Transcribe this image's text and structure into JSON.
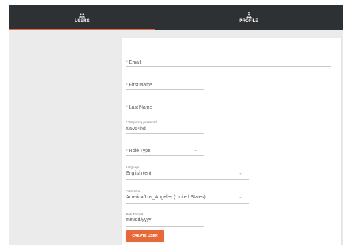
{
  "tabs": {
    "users": {
      "label": "USERS",
      "icon": "users-icon"
    },
    "profile": {
      "label": "PROFILE",
      "icon": "user-icon"
    }
  },
  "form": {
    "email": {
      "placeholder": "* Email"
    },
    "first_name": {
      "placeholder": "* First Name"
    },
    "last_name": {
      "placeholder": "* Last Name"
    },
    "temp_password": {
      "label": "* Temporary password",
      "value": "fu5v54hd"
    },
    "role_type": {
      "placeholder": "* Role Type"
    },
    "language": {
      "label": "Language",
      "value": "English (en)"
    },
    "time_zone": {
      "label": "Time Zone",
      "value": "America/Los_Angeles (United States)"
    },
    "date_format": {
      "label": "Date Format",
      "value": "mm/dd/yyyy"
    },
    "create_button": "CREATE USER"
  },
  "colors": {
    "accent": "#e8683a",
    "topbar": "#2e3133"
  }
}
